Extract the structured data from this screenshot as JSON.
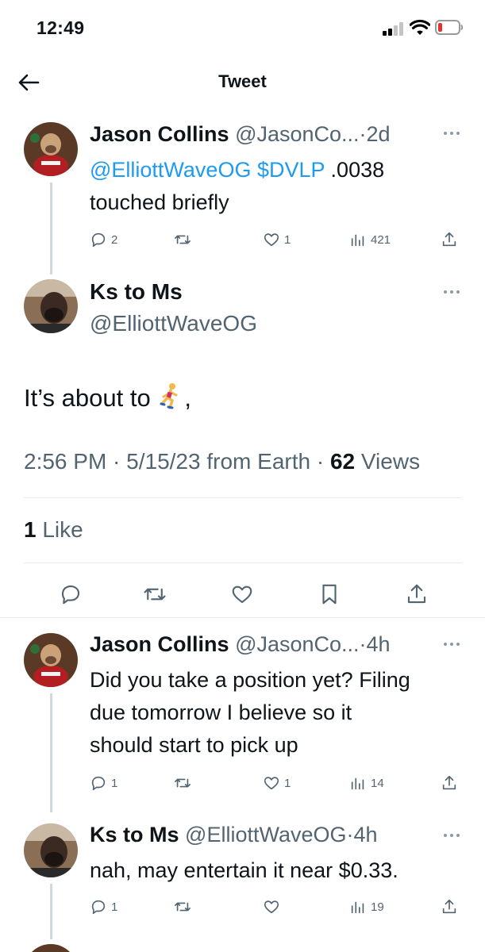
{
  "status_bar": {
    "time": "12:49"
  },
  "header": {
    "title": "Tweet"
  },
  "parent_tweet": {
    "name": "Jason Collins",
    "handle_time": "@JasonCo...·2d",
    "mention": "@ElliottWaveOG",
    "cashtag": "$DVLP",
    "text_rest": ".0038",
    "text_line2": "touched briefly",
    "replies": "2",
    "retweets": "",
    "likes": "1",
    "views": "421"
  },
  "main_tweet": {
    "name": "Ks to Ms",
    "handle": "@ElliottWaveOG",
    "text": "It’s about to",
    "text_suffix": ",",
    "time": "2:56 PM · 5/15/23 from Earth ·",
    "views_count": "62",
    "views_label": " Views",
    "likes_count": "1",
    "likes_label": " Like"
  },
  "replies": [
    {
      "name": "Jason Collins",
      "handle_time": "@JasonCo...·4h",
      "lines": [
        "Did you take a position yet? Filing",
        "due tomorrow I believe so it",
        "should start to pick up"
      ],
      "replies": "1",
      "likes": "1",
      "views": "14"
    },
    {
      "name": "Ks to Ms",
      "handle_time": "@ElliottWaveOG·4h",
      "lines": [
        "nah, may entertain it near $0.33."
      ],
      "replies": "1",
      "likes": "",
      "views": "19"
    }
  ],
  "colors": {
    "link": "#1d9bf0",
    "secondary": "#536471",
    "divider": "#e6ecf0"
  },
  "icons": [
    "back-arrow-icon",
    "more-icon",
    "reply-icon",
    "retweet-icon",
    "like-icon",
    "views-icon",
    "share-icon",
    "bookmark-icon"
  ]
}
